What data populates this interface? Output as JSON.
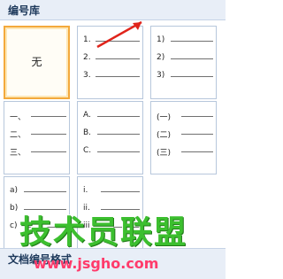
{
  "gallery": {
    "title": "编号库",
    "none_label": "无",
    "tiles": [
      {
        "items": [
          "1.",
          "2.",
          "3."
        ]
      },
      {
        "items": [
          "1)",
          "2)",
          "3)"
        ]
      },
      {
        "items": [
          "一、",
          "二、",
          "三、"
        ]
      },
      {
        "items": [
          "A.",
          "B.",
          "C."
        ]
      },
      {
        "items": [
          "(一)",
          "(二)",
          "(三)"
        ]
      },
      {
        "items": [
          "a)",
          "b)",
          "c)"
        ]
      },
      {
        "items": [
          "i.",
          "ii.",
          "iii."
        ]
      }
    ]
  },
  "next_section": {
    "title": "文档编号格式"
  },
  "watermark": {
    "text": "技术员联盟",
    "url": "www.jsgho.com"
  },
  "colors": {
    "selected_border": "#f3a93c",
    "arrow": "#e0241b",
    "header_bg": "#e8eef7"
  }
}
